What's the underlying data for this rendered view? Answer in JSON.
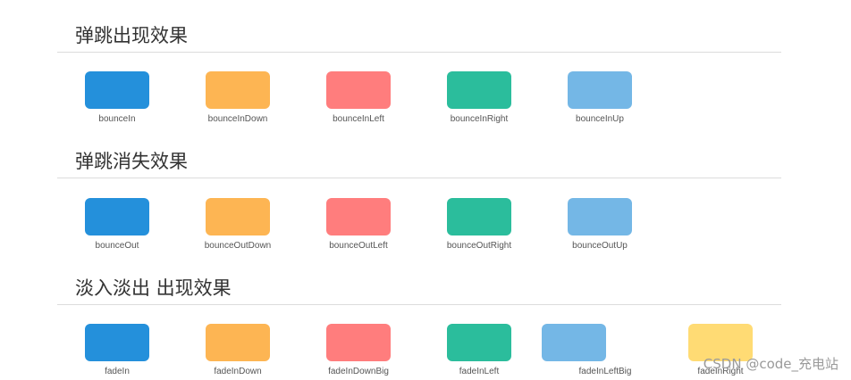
{
  "colors": {
    "blue": "#2490db",
    "orange": "#fdb553",
    "red": "#ff7d7d",
    "teal": "#2bbd9c",
    "lightblue": "#74b7e6",
    "yellow": "#ffdb74"
  },
  "sections": [
    {
      "title": "弹跳出现效果",
      "items": [
        {
          "label": "bounceIn",
          "color": "#2490db"
        },
        {
          "label": "bounceInDown",
          "color": "#fdb553"
        },
        {
          "label": "bounceInLeft",
          "color": "#ff7d7d"
        },
        {
          "label": "bounceInRight",
          "color": "#2bbd9c"
        },
        {
          "label": "bounceInUp",
          "color": "#74b7e6"
        }
      ]
    },
    {
      "title": "弹跳消失效果",
      "items": [
        {
          "label": "bounceOut",
          "color": "#2490db"
        },
        {
          "label": "bounceOutDown",
          "color": "#fdb553"
        },
        {
          "label": "bounceOutLeft",
          "color": "#ff7d7d"
        },
        {
          "label": "bounceOutRight",
          "color": "#2bbd9c"
        },
        {
          "label": "bounceOutUp",
          "color": "#74b7e6"
        }
      ]
    },
    {
      "title": "淡入淡出 出现效果",
      "items": [
        {
          "label": "fadeIn",
          "color": "#2490db"
        },
        {
          "label": "fadeInDown",
          "color": "#fdb553"
        },
        {
          "label": "fadeInDownBig",
          "color": "#ff7d7d"
        },
        {
          "label": "fadeInLeft",
          "color": "#2bbd9c"
        },
        {
          "label": "fadeInLeftBig",
          "color": "#74b7e6"
        },
        {
          "label": "fadeInRight",
          "color": "#ffdb74"
        }
      ]
    }
  ],
  "watermark": "CSDN @code_充电站"
}
